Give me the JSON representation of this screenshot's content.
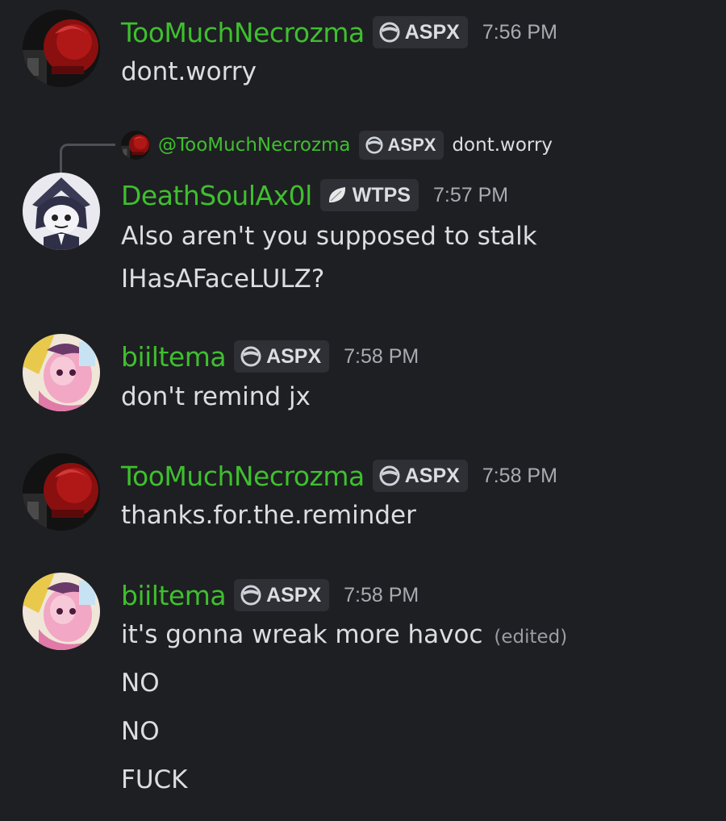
{
  "colors": {
    "background": "#1e1f22",
    "username": "#3fbf2f",
    "tag_bg": "#2e3035",
    "text": "#dbdee1",
    "timestamp": "#a8abb2"
  },
  "messages": [
    {
      "username": "TooMuchNecrozma",
      "tag": "ASPX",
      "tag_icon": "circle-badge-icon",
      "time": "7:56 PM",
      "lines": [
        "dont.worry"
      ]
    },
    {
      "reply": {
        "mention": "@TooMuchNecrozma",
        "tag": "ASPX",
        "text": "dont.worry"
      },
      "username": "DeathSoulAx0l",
      "tag": "WTPS",
      "tag_icon": "leaf-badge-icon",
      "time": "7:57 PM",
      "lines": [
        "Also aren't you supposed to stalk",
        "IHasAFaceLULZ?"
      ]
    },
    {
      "username": "biiltema",
      "tag": "ASPX",
      "tag_icon": "circle-badge-icon",
      "time": "7:58 PM",
      "lines": [
        "don't remind jx"
      ]
    },
    {
      "username": "TooMuchNecrozma",
      "tag": "ASPX",
      "tag_icon": "circle-badge-icon",
      "time": "7:58 PM",
      "lines": [
        "thanks.for.the.reminder"
      ]
    },
    {
      "username": "biiltema",
      "tag": "ASPX",
      "tag_icon": "circle-badge-icon",
      "time": "7:58 PM",
      "lines": [
        "it's gonna wreak more havoc",
        "NO",
        "NO",
        "FUCK"
      ],
      "edited": "(edited)"
    }
  ]
}
